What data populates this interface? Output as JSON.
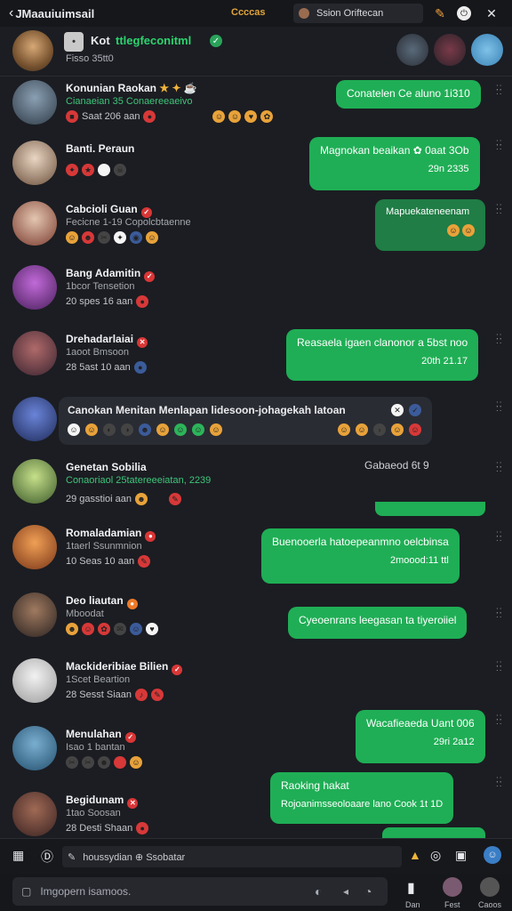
{
  "topbar": {
    "back_icon": "‹",
    "title": "JMaauiuimsail",
    "badge": "Ccccas",
    "search_text": "Ssion Oriftecan"
  },
  "header": {
    "name": "Kot",
    "tag": "ttlegfeconitml",
    "sub": "Fisso   35tt0"
  },
  "rows": [
    {
      "name": "Konunian Raokan",
      "extra": "★ ✦ ☕",
      "sub": "Cianaeian 35 Conaereeaeivo",
      "meta": "Saat 206 aan",
      "bubble": "Conatelen Ce aluno 1i310"
    },
    {
      "name": "Banti. Peraun",
      "bubble": "Magnokan beaikan ✿ 0aat 3Ob",
      "bubble_time": "29n 2335"
    },
    {
      "name": "Cabcioli Guan",
      "sub": "Fecicne 1-19 Copolcbtaenne",
      "bubble": "Mapuekateneenam"
    },
    {
      "name": "Bang Adamitin",
      "sub": "1bcor Tensetion",
      "meta": "20 spes 16 aan"
    },
    {
      "name": "Drehadarlaiai",
      "sub": "1aoot Bmsoon",
      "meta": "28 5ast 10 aan",
      "bubble": "Reasaela igaen clanonor a 5bst noo",
      "bubble_time": "20th 21.17"
    },
    {
      "name": "Genetan Sobilia",
      "sub": "Conaoriaol 25tatereeeiatan, 2239",
      "meta": "29 gasstioi aan",
      "time_right": "Gabaeod 6t 9"
    },
    {
      "name": "Romaladamian",
      "sub": "1taerl Ssunmnion",
      "meta": "10 Seas 10 aan",
      "bubble": "Buenooerla hatoepeanmno oelcbinsa",
      "bubble_time": "2moood:11 ttl"
    },
    {
      "name": "Deo liautan",
      "sub": "Mboodat",
      "bubble": "Cyeoenrans leegasan ta tiyeroiiel"
    },
    {
      "name": "Mackideribiae Bilien",
      "sub": "1Scet Beartion",
      "meta": "28 Sesst Siaan"
    },
    {
      "name": "Menulahan",
      "sub": "Isao 1 bantan"
    },
    {
      "name": "Begidunam",
      "sub": "1tao Soosan",
      "meta": "28 Desti Shaan",
      "bubble": "Wacafieaeda Uant 006",
      "bubble_time": "29ri 2a12"
    }
  ],
  "popup": {
    "text": "Canokan Menitan Menlapan lidesoon-johagekah latoan"
  },
  "bubble_last": {
    "line1": "Raoking hakat",
    "line2": "Rojoanimsseoloaare lano Cook 1t 1D"
  },
  "compose": {
    "text": "houssydian ⊕ Ssobatar"
  },
  "bottom": {
    "placeholder": "Imgopern isamoos.",
    "nav": [
      "Dan",
      "Fest",
      "Caoos"
    ]
  }
}
